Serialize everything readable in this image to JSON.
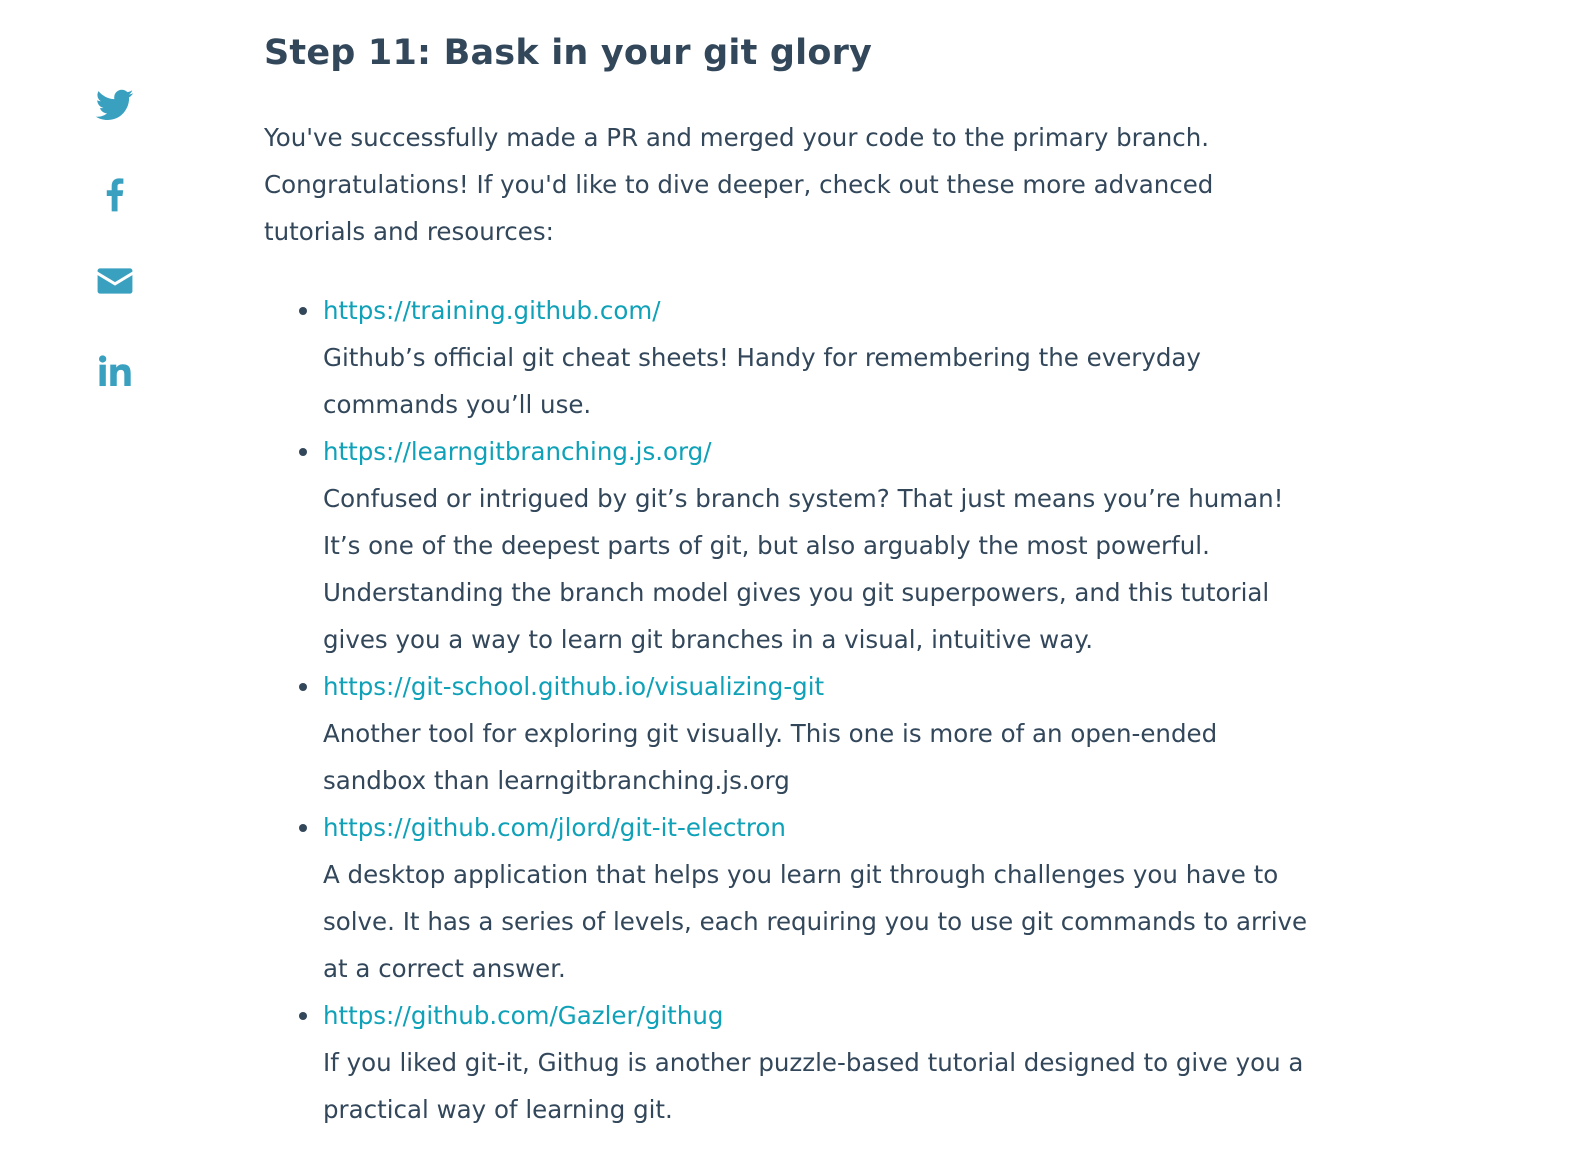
{
  "share": {
    "icons": [
      "twitter-icon",
      "facebook-icon",
      "email-icon",
      "linkedin-icon"
    ],
    "color": "#3aa0c0"
  },
  "article": {
    "title": "Step 11: Bask in your git glory",
    "intro": "You've successfully made a PR and merged your code to the primary branch. Congratulations! If you'd like to dive deeper, check out these more advanced tutorials and resources:",
    "resources": [
      {
        "url": "https://training.github.com/",
        "desc": "Github’s official git cheat sheets! Handy for remembering the everyday commands you’ll use."
      },
      {
        "url": "https://learngitbranching.js.org/",
        "desc": "Confused or intrigued by git’s branch system? That just means you’re human! It’s one of the deepest parts of git, but also arguably the most powerful. Understanding the branch model gives you git superpowers, and this tutorial gives you a way to learn git branches in a visual, intuitive way."
      },
      {
        "url": "https://git-school.github.io/visualizing-git",
        "desc": "Another tool for exploring git visually. This one is more of an open-ended sandbox than learngitbranching.js.org"
      },
      {
        "url": "https://github.com/jlord/git-it-electron",
        "desc": "A desktop application that helps you learn git through challenges you have to solve. It has a series of levels, each requiring you to use git commands to arrive at a correct answer."
      },
      {
        "url": "https://github.com/Gazler/githug",
        "desc": "If you liked git-it, Githug is another puzzle-based tutorial designed to give you a practical way of learning git."
      }
    ]
  },
  "colors": {
    "text": "#33475b",
    "link": "#0fa1b8",
    "icon": "#3aa0c0"
  }
}
